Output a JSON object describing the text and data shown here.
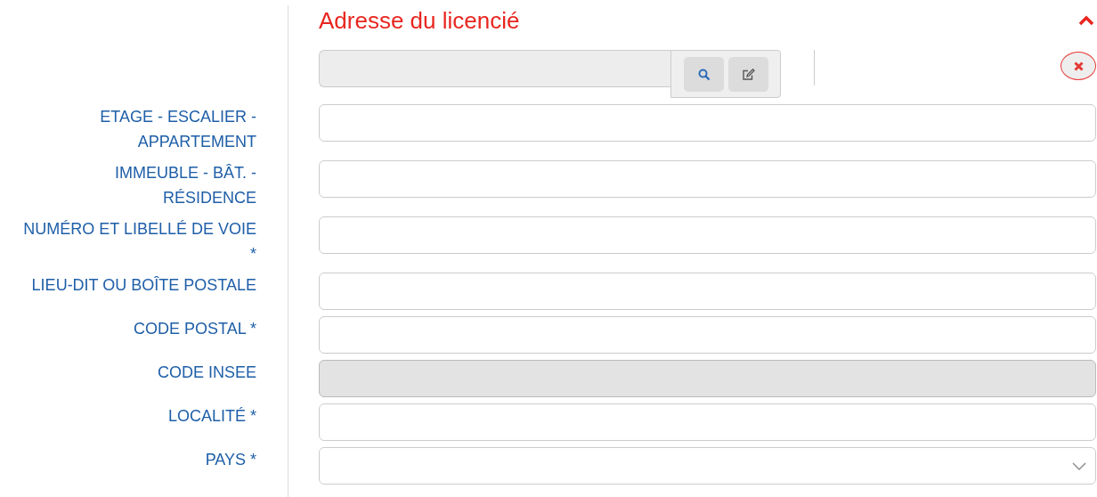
{
  "section": {
    "title": "Adresse du licencié",
    "expanded": true
  },
  "lookup": {
    "disabled": true
  },
  "fields": [
    {
      "label": "ETAGE - ESCALIER - APPARTEMENT",
      "kind": "text",
      "disabled": false
    },
    {
      "label": "IMMEUBLE - BÂT. - RÉSIDENCE",
      "kind": "text",
      "disabled": false
    },
    {
      "label": "NUMÉRO ET LIBELLÉ DE VOIE *",
      "kind": "text",
      "disabled": false
    },
    {
      "label": "LIEU-DIT OU BOÎTE POSTALE",
      "kind": "text",
      "disabled": false
    },
    {
      "label": "CODE POSTAL *",
      "kind": "text",
      "disabled": false
    },
    {
      "label": "CODE INSEE",
      "kind": "text",
      "disabled": true
    },
    {
      "label": "LOCALITÉ *",
      "kind": "text",
      "disabled": false
    },
    {
      "label": "PAYS *",
      "kind": "select",
      "disabled": false
    }
  ]
}
